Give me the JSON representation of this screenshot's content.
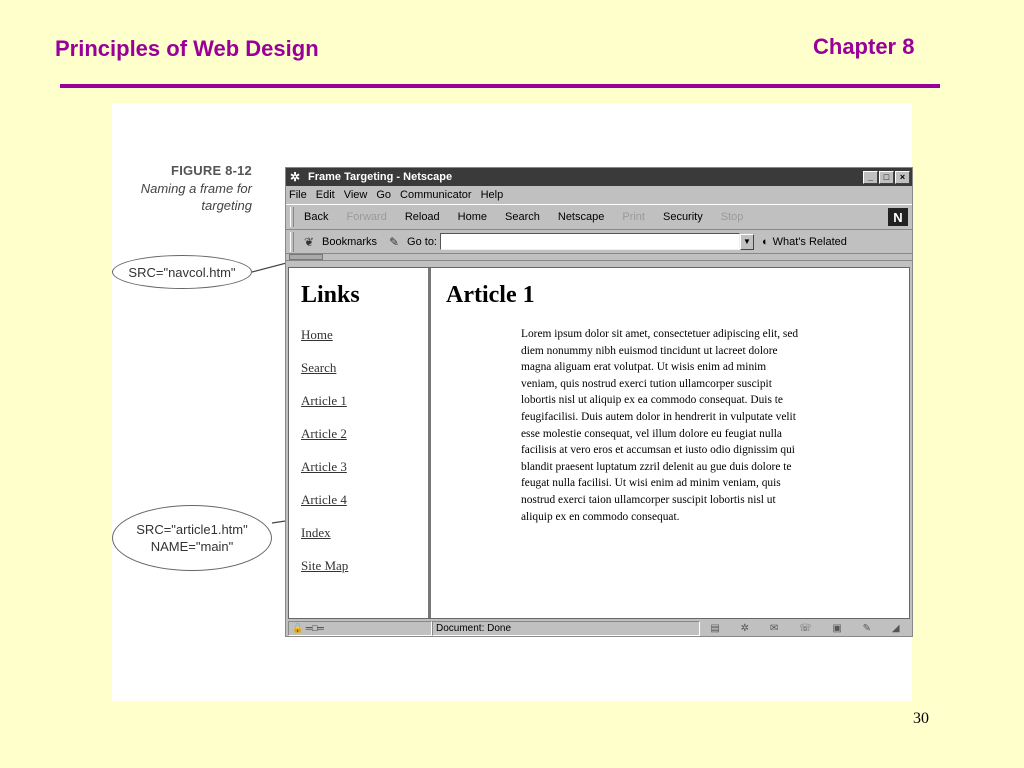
{
  "slide": {
    "title": "Principles of Web Design",
    "chapter": "Chapter 8",
    "page_number": "30",
    "accent_color": "#990099",
    "background_color": "#ffffcc"
  },
  "figure": {
    "label": "FIGURE 8-12",
    "caption_lines": [
      "Naming a frame for",
      "targeting"
    ],
    "callout_navcol": "SRC=\"navcol.htm\"",
    "callout_main_lines": [
      "SRC=\"article1.htm\"",
      "NAME=\"main\""
    ]
  },
  "browser": {
    "window_title": "Frame Targeting - Netscape",
    "window_buttons": [
      "_",
      "□",
      "×"
    ],
    "menu": [
      "File",
      "Edit",
      "View",
      "Go",
      "Communicator",
      "Help"
    ],
    "toolbar": [
      {
        "label": "Back",
        "enabled": true
      },
      {
        "label": "Forward",
        "enabled": false
      },
      {
        "label": "Reload",
        "enabled": true
      },
      {
        "label": "Home",
        "enabled": true
      },
      {
        "label": "Search",
        "enabled": true
      },
      {
        "label": "Netscape",
        "enabled": true
      },
      {
        "label": "Print",
        "enabled": false
      },
      {
        "label": "Security",
        "enabled": true
      },
      {
        "label": "Stop",
        "enabled": false
      }
    ],
    "logo": "N",
    "bookmarks_label": "Bookmarks",
    "goto_label": "Go to:",
    "location_value": "",
    "whats_related": "What's Related",
    "status_text": "Document: Done"
  },
  "nav_frame": {
    "heading": "Links",
    "links": [
      "Home",
      "Search",
      "Article 1",
      "Article 2",
      "Article 3",
      "Article 4",
      "Index",
      "Site Map"
    ]
  },
  "main_frame": {
    "heading": "Article 1",
    "body": "Lorem ipsum dolor sit amet, consectetuer adipiscing elit, sed diem nonummy nibh euismod tincidunt ut lacreet dolore magna aliguam erat volutpat. Ut wisis enim ad minim veniam, quis nostrud exerci tution ullamcorper suscipit lobortis nisl ut aliquip ex ea commodo consequat. Duis te feugifacilisi. Duis autem dolor in hendrerit in vulputate velit esse molestie consequat, vel illum dolore eu feugiat nulla facilisis at vero eros et accumsan et iusto odio dignissim qui blandit praesent luptatum zzril delenit au gue duis dolore te feugat nulla facilisi. Ut wisi enim ad minim veniam, quis nostrud exerci taion ullamcorper suscipit lobortis nisl ut aliquip ex en commodo consequat."
  }
}
